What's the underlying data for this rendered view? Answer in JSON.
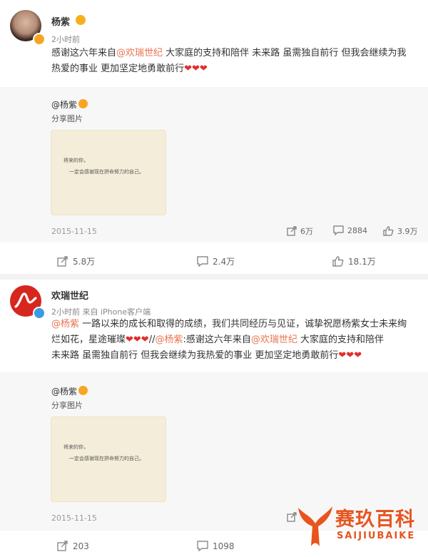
{
  "post1": {
    "author": "杨紫",
    "time": "2小时前",
    "text_a": "感谢这六年来自",
    "mention_a": "@欢瑞世纪",
    "text_b": " 大家庭的支持和陪伴 未来路 虽需独自前行 但我会继续为我",
    "text_c": "热爱的事业 更加坚定地勇敢前行",
    "hearts": "❤❤❤",
    "repost": {
      "author": "@杨紫",
      "subtitle": "分享图片",
      "card_line1": "将来的你，",
      "card_line2": "一定会感谢现在拼命努力的自己。",
      "date": "2015-11-15",
      "stats": {
        "shares": "6万",
        "comments": "2884",
        "likes": "3.9万"
      }
    },
    "actions": {
      "share": "5.8万",
      "comment": "2.4万",
      "like": "18.1万"
    }
  },
  "post2": {
    "author": "欢瑞世纪",
    "time": "2小时前 来自 iPhone客户端",
    "mention_a": "@杨紫",
    "text_a": " 一路以来的成长和取得的成绩，我们共同经历与见证，诚挚祝愿杨紫女士未来绚",
    "text_b": "烂如花，星途璀璨",
    "hearts_a": "❤❤❤",
    "sep": "//",
    "mention_b": "@杨紫",
    "text_c": ":感谢这六年来自",
    "mention_c": "@欢瑞世纪",
    "text_d": " 大家庭的支持和陪伴",
    "text_e": "未来路 虽需独自前行 但我会继续为我热爱的事业 更加坚定地勇敢前行",
    "hearts_b": "❤❤❤",
    "repost": {
      "author": "@杨紫",
      "subtitle": "分享图片",
      "card_line1": "将来的你，",
      "card_line2": "一定会感谢现在拼命努力的自己。",
      "date": "2015-11-15"
    },
    "actions": {
      "share": "203",
      "comment": "1098"
    }
  },
  "watermark": {
    "title": "赛玖百科",
    "subtitle": "SAIJIUBAIKE",
    "color": "#e8541e"
  }
}
